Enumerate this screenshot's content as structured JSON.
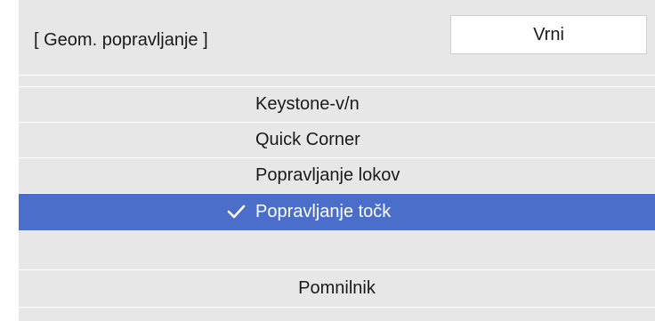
{
  "header": {
    "title": "[ Geom. popravljanje ]",
    "back_label": "Vrni"
  },
  "menu": {
    "items": [
      {
        "label": "Keystone-v/n",
        "selected": false
      },
      {
        "label": "Quick Corner",
        "selected": false
      },
      {
        "label": "Popravljanje lokov",
        "selected": false
      },
      {
        "label": "Popravljanje točk",
        "selected": true
      }
    ],
    "memory_label": "Pomnilnik"
  },
  "colors": {
    "panel_bg": "#e7e7e7",
    "selected_bg": "#4a6ec9",
    "text": "#1a1a1a"
  },
  "icons": {
    "selected_marker": "checkmark-icon"
  }
}
